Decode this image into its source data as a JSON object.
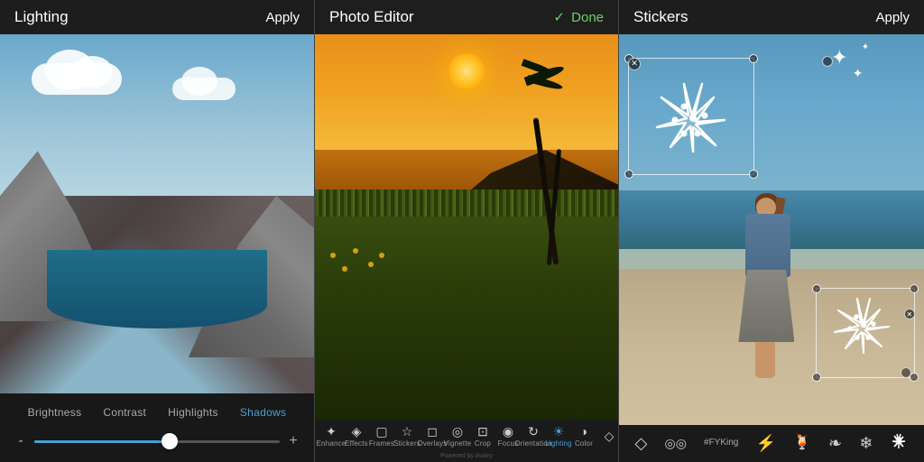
{
  "panels": {
    "left": {
      "title": "Lighting",
      "action": "Apply",
      "tabs": [
        {
          "id": "brightness",
          "label": "Brightness",
          "active": false
        },
        {
          "id": "contrast",
          "label": "Contrast",
          "active": false
        },
        {
          "id": "highlights",
          "label": "Highlights",
          "active": false
        },
        {
          "id": "shadows",
          "label": "Shadows",
          "active": true
        }
      ],
      "slider": {
        "min": "-",
        "max": "+",
        "value": 55
      }
    },
    "middle": {
      "title": "Photo Editor",
      "action": "Done",
      "tools": [
        {
          "id": "enhance",
          "icon": "✦",
          "label": "Enhance"
        },
        {
          "id": "effects",
          "icon": "◈",
          "label": "Effects"
        },
        {
          "id": "frames",
          "icon": "▢",
          "label": "Frames"
        },
        {
          "id": "stickers",
          "icon": "☆",
          "label": "Stickers"
        },
        {
          "id": "overlays",
          "icon": "◻",
          "label": "Overlays"
        },
        {
          "id": "vignette",
          "icon": "◎",
          "label": "Vignette"
        },
        {
          "id": "crop",
          "icon": "⊡",
          "label": "Crop"
        },
        {
          "id": "focus",
          "icon": "◉",
          "label": "Focus"
        },
        {
          "id": "orientation",
          "icon": "↻",
          "label": "Orientation"
        },
        {
          "id": "lighting",
          "icon": "☀",
          "label": "Lighting"
        },
        {
          "id": "color",
          "icon": "◑",
          "label": "Color"
        },
        {
          "id": "sharpen",
          "icon": "◇",
          "label": ""
        }
      ],
      "powered_by": "Powered by Aviary"
    },
    "right": {
      "title": "Stickers",
      "action": "Apply",
      "sticker_tools": [
        {
          "id": "diamond",
          "icon": "◇"
        },
        {
          "id": "glasses",
          "icon": "◎"
        },
        {
          "id": "hashtag",
          "icon": "#",
          "label": "#FYKing"
        },
        {
          "id": "lightning",
          "icon": "⚡"
        },
        {
          "id": "cocktail",
          "icon": "🍹"
        },
        {
          "id": "feather",
          "icon": "❧"
        },
        {
          "id": "snowflake",
          "icon": "❄"
        },
        {
          "id": "starfish",
          "icon": "✦"
        }
      ]
    }
  }
}
